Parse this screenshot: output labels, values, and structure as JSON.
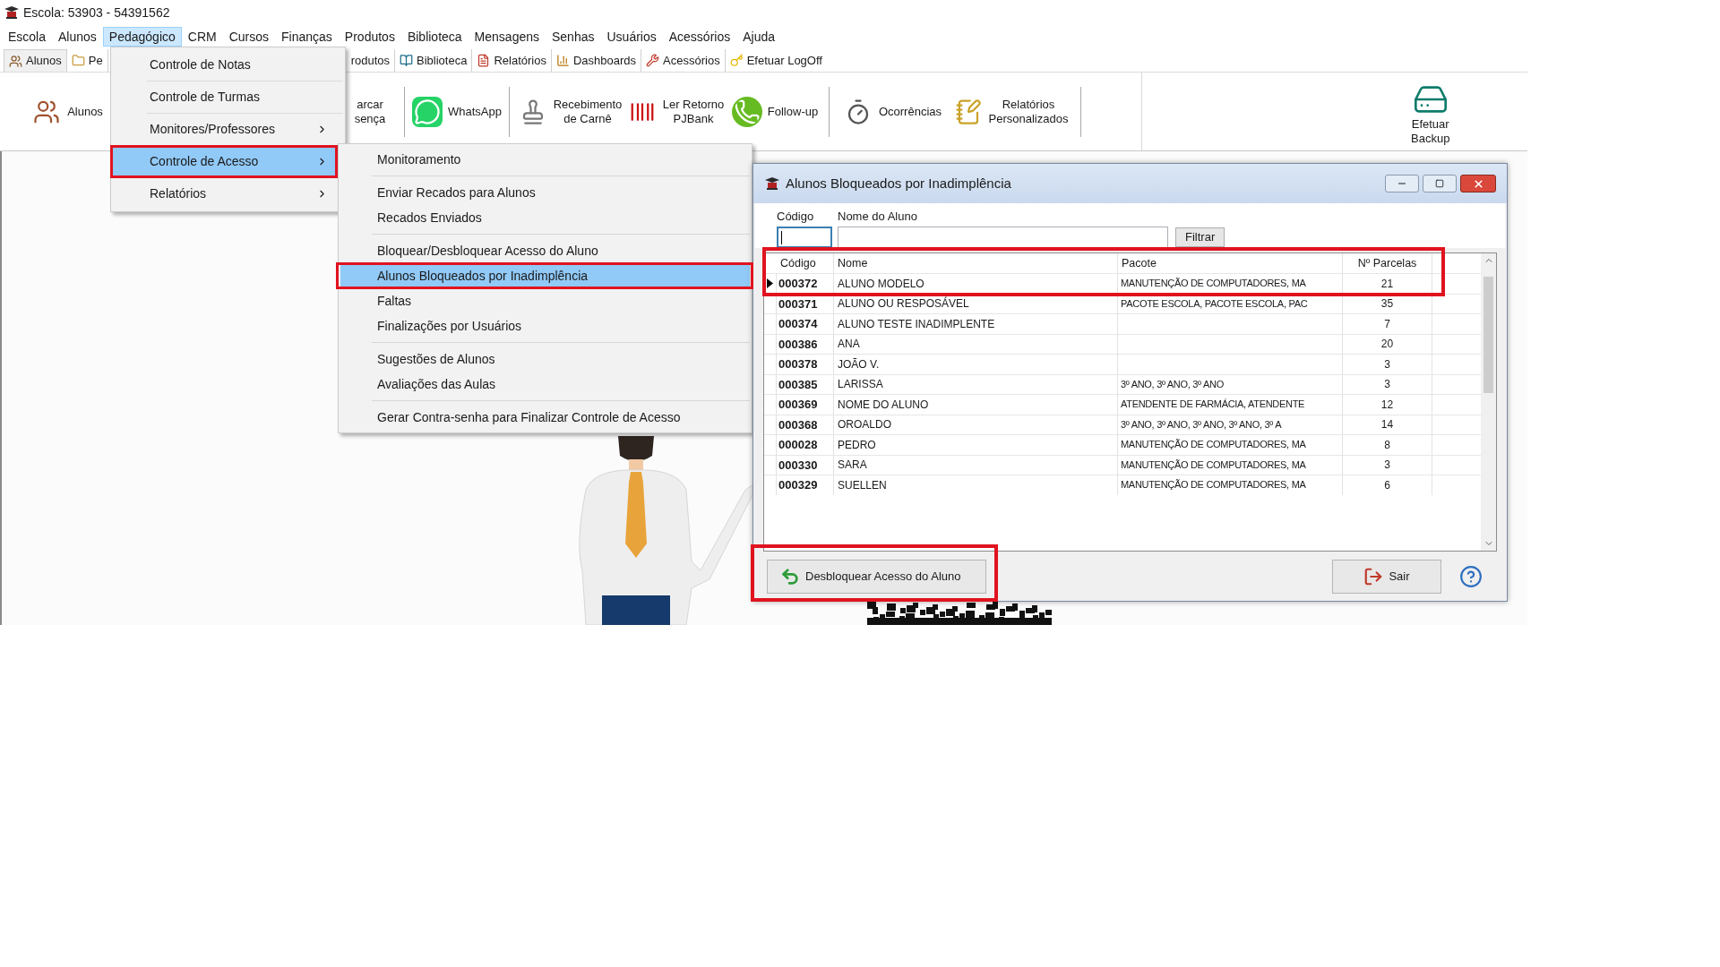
{
  "window": {
    "title": "Escola: 53903 - 54391562"
  },
  "menu_bar": [
    {
      "label": "Escola",
      "selected": false
    },
    {
      "label": "Alunos",
      "selected": false
    },
    {
      "label": "Pedagógico",
      "selected": true
    },
    {
      "label": "CRM",
      "selected": false
    },
    {
      "label": "Cursos",
      "selected": false
    },
    {
      "label": "Finanças",
      "selected": false
    },
    {
      "label": "Produtos",
      "selected": false
    },
    {
      "label": "Biblioteca",
      "selected": false
    },
    {
      "label": "Mensagens",
      "selected": false
    },
    {
      "label": "Senhas",
      "selected": false
    },
    {
      "label": "Usuários",
      "selected": false
    },
    {
      "label": "Acessórios",
      "selected": false
    },
    {
      "label": "Ajuda",
      "selected": false
    }
  ],
  "tab_bar": [
    {
      "label": "Alunos",
      "selected": true
    },
    {
      "label": "Pe",
      "selected": false
    },
    {
      "label": "rodutos",
      "selected": false
    },
    {
      "label": "Biblioteca",
      "selected": false
    },
    {
      "label": "Relatórios",
      "selected": false
    },
    {
      "label": "Dashboards",
      "selected": false
    },
    {
      "label": "Acessórios",
      "selected": false
    },
    {
      "label": "Efetuar LogOff",
      "selected": false
    }
  ],
  "ribbon": [
    {
      "kind": "item",
      "lines": [
        "Alunos"
      ]
    },
    {
      "kind": "item",
      "lines": [
        "arcar",
        "sença"
      ]
    },
    {
      "kind": "separator"
    },
    {
      "kind": "item",
      "lines": [
        "WhatsApp"
      ]
    },
    {
      "kind": "separator"
    },
    {
      "kind": "item",
      "lines": [
        "Recebimento",
        "de Carnê"
      ]
    },
    {
      "kind": "item",
      "lines": [
        "Ler Retorno",
        "PJBank"
      ]
    },
    {
      "kind": "item",
      "lines": [
        "Follow-up"
      ]
    },
    {
      "kind": "separator"
    },
    {
      "kind": "item",
      "lines": [
        "Ocorrências"
      ]
    },
    {
      "kind": "item",
      "lines": [
        "Relatórios",
        "Personalizados"
      ]
    },
    {
      "kind": "separator"
    }
  ],
  "backup_button": {
    "lines": [
      "Efetuar",
      "Backup"
    ]
  },
  "pedagogico_menu": [
    {
      "label": "Controle de Notas",
      "submenu": false,
      "selected": false
    },
    {
      "label": "Controle de Turmas",
      "submenu": false,
      "selected": false
    },
    {
      "label": "Monitores/Professores",
      "submenu": true,
      "selected": false
    },
    {
      "label": "Controle de Acesso",
      "submenu": true,
      "selected": true
    },
    {
      "label": "Relatórios",
      "submenu": true,
      "selected": false
    }
  ],
  "access_submenu": [
    {
      "kind": "item",
      "label": "Monitoramento",
      "selected": false
    },
    {
      "kind": "separator"
    },
    {
      "kind": "item",
      "label": "Enviar Recados para Alunos",
      "selected": false
    },
    {
      "kind": "item",
      "label": "Recados Enviados",
      "selected": false
    },
    {
      "kind": "separator"
    },
    {
      "kind": "item",
      "label": "Bloquear/Desbloquear Acesso do Aluno",
      "selected": false
    },
    {
      "kind": "item",
      "label": "Alunos Bloqueados por Inadimplência",
      "selected": true
    },
    {
      "kind": "item",
      "label": "Faltas",
      "selected": false
    },
    {
      "kind": "item",
      "label": "Finalizações por Usuários",
      "selected": false
    },
    {
      "kind": "separator"
    },
    {
      "kind": "item",
      "label": "Sugestões de Alunos",
      "selected": false
    },
    {
      "kind": "item",
      "label": "Avaliações das Aulas",
      "selected": false
    },
    {
      "kind": "separator"
    },
    {
      "kind": "item",
      "label": "Gerar Contra-senha para Finalizar Controle de Acesso",
      "selected": false
    }
  ],
  "dialog": {
    "title": "Alunos Bloqueados por Inadimplência",
    "fields": [
      {
        "label": "Código",
        "focused": true
      },
      {
        "label": "Nome do Aluno",
        "focused": false
      }
    ],
    "filter_button": "Filtrar",
    "table": {
      "columns": [
        "Código",
        "Nome",
        "Pacote",
        "Nº Parcelas"
      ],
      "rows": [
        {
          "code": "000372",
          "name": "ALUNO MODELO",
          "package": "MANUTENÇÃO DE COMPUTADORES, MA",
          "installments": "21",
          "selected": true
        },
        {
          "code": "000371",
          "name": "ALUNO OU RESPOSÁVEL",
          "package": "PACOTE ESCOLA, PACOTE ESCOLA, PAC",
          "installments": "35",
          "selected": false
        },
        {
          "code": "000374",
          "name": "ALUNO TESTE INADIMPLENTE",
          "package": "",
          "installments": "7",
          "selected": false
        },
        {
          "code": "000386",
          "name": "ANA",
          "package": "",
          "installments": "20",
          "selected": false
        },
        {
          "code": "000378",
          "name": "JOÃO V.",
          "package": "",
          "installments": "3",
          "selected": false
        },
        {
          "code": "000385",
          "name": "LARISSA",
          "package": "3º ANO, 3º ANO, 3º ANO",
          "installments": "3",
          "selected": false
        },
        {
          "code": "000369",
          "name": "NOME DO ALUNO",
          "package": "ATENDENTE DE FARMÁCIA, ATENDENTE",
          "installments": "12",
          "selected": false
        },
        {
          "code": "000368",
          "name": "OROALDO",
          "package": "3º ANO, 3º ANO, 3º ANO, 3º ANO, 3º A",
          "installments": "14",
          "selected": false
        },
        {
          "code": "000028",
          "name": "PEDRO",
          "package": "MANUTENÇÃO DE COMPUTADORES, MA",
          "installments": "8",
          "selected": false
        },
        {
          "code": "000330",
          "name": "SARA",
          "package": "MANUTENÇÃO DE COMPUTADORES, MA",
          "installments": "3",
          "selected": false
        },
        {
          "code": "000329",
          "name": "SUELLEN",
          "package": "MANUTENÇÃO DE COMPUTADORES, MA",
          "installments": "6",
          "selected": false
        }
      ]
    },
    "unlock_button": "Desbloquear Acesso do Aluno",
    "exit_button": "Sair"
  }
}
